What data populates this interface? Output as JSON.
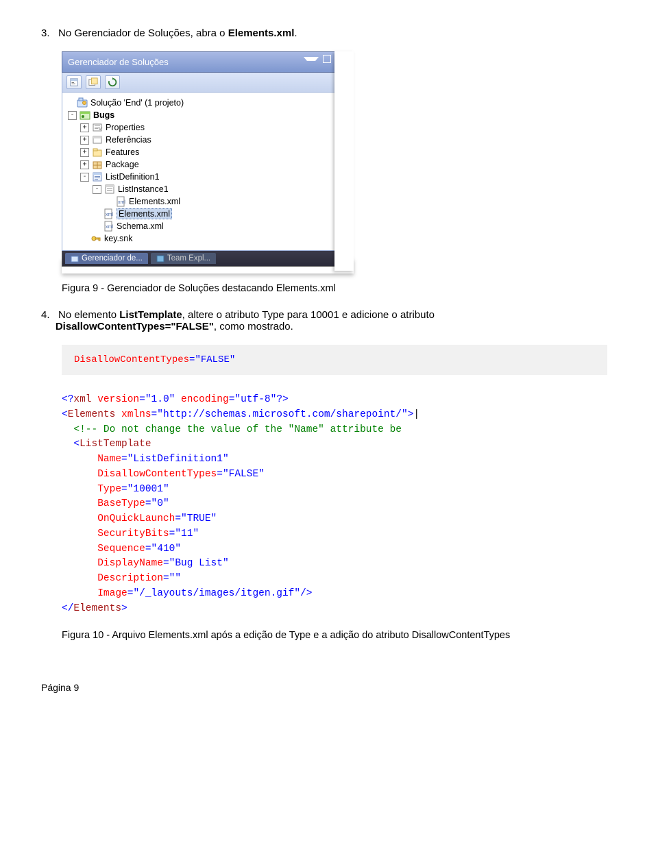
{
  "step3": {
    "num": "3.",
    "text_before": "No Gerenciador de Soluções, abra o ",
    "bold": "Elements.xml",
    "text_after": "."
  },
  "panel": {
    "title": "Gerenciador de Soluções",
    "toolbar": [
      "properties",
      "show-all",
      "refresh"
    ],
    "tree": {
      "solution": "Solução 'End' (1 projeto)",
      "project": "Bugs",
      "items": [
        "Properties",
        "Referências",
        "Features",
        "Package",
        "ListDefinition1"
      ],
      "listdef_children": {
        "instance": "ListInstance1",
        "instance_child": "Elements.xml",
        "selected": "Elements.xml",
        "schema": "Schema.xml"
      },
      "key": "key.snk"
    },
    "bottom_tabs": {
      "active_prefix": "Gerenciador de...",
      "inactive": "Team Expl..."
    }
  },
  "caption9": "Figura 9 - Gerenciador de Soluções destacando Elements.xml",
  "step4": {
    "num": "4.",
    "t1": "No elemento ",
    "b1": "ListTemplate",
    "t2": ", altere o atributo Type para 10001 e adicione o atributo ",
    "b2": "DisallowContentTypes=\"FALSE\"",
    "t3": ", como mostrado."
  },
  "codebox": {
    "attr": "DisallowContentTypes",
    "eq": "=",
    "val": "\"FALSE\""
  },
  "xml": {
    "decl_open": "<?",
    "decl_name": "xml",
    "decl_attrs_v": " version",
    "decl_v_val": "\"1.0\"",
    "decl_attrs_e": " encoding",
    "decl_e_val": "\"utf-8\"",
    "decl_close": "?>",
    "el_open_lt": "<",
    "el_elements": "Elements",
    "xmlns_attr": " xmlns",
    "xmlns_val": "\"http://schemas.microsoft.com/sharepoint/\"",
    "gt": ">",
    "cursor": "|",
    "comment": "<!-- Do not change the value of the \"Name\" attribute be",
    "lt_name": "ListTemplate",
    "attr_name_k": "Name",
    "attr_name_v": "\"ListDefinition1\"",
    "attr_dct_k": "DisallowContentTypes",
    "attr_dct_v": "\"FALSE\"",
    "attr_type_k": "Type",
    "attr_type_v": "\"10001\"",
    "attr_bt_k": "BaseType",
    "attr_bt_v": "\"0\"",
    "attr_oql_k": "OnQuickLaunch",
    "attr_oql_v": "\"TRUE\"",
    "attr_sb_k": "SecurityBits",
    "attr_sb_v": "\"11\"",
    "attr_seq_k": "Sequence",
    "attr_seq_v": "\"410\"",
    "attr_dn_k": "DisplayName",
    "attr_dn_v": "\"Bug List\"",
    "attr_desc_k": "Description",
    "attr_desc_v": "\"\"",
    "attr_img_k": "Image",
    "attr_img_v": "\"/_layouts/images/itgen.gif\"",
    "selfclose": "/>",
    "close_elements": "</",
    "close_elements_name": "Elements"
  },
  "caption10": "Figura 10 - Arquivo Elements.xml após a edição de Type e a adição do atributo DisallowContentTypes",
  "footer": "Página 9"
}
